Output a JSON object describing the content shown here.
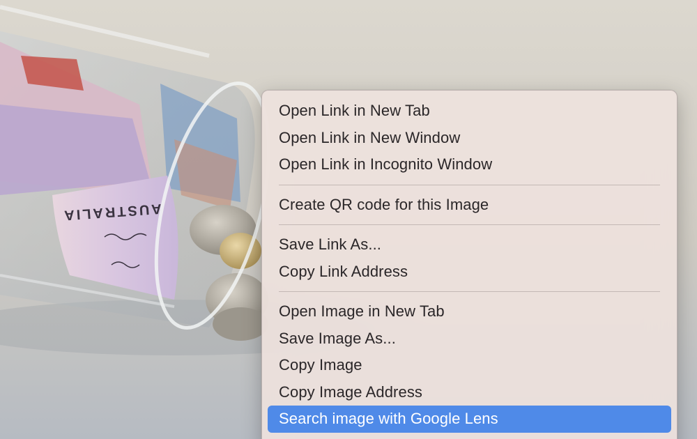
{
  "background": {
    "description_icon": "jar-of-money-photo",
    "banknote_text": "AUSTRALIA"
  },
  "context_menu": {
    "groups": [
      {
        "items": [
          {
            "label": "Open Link in New Tab"
          },
          {
            "label": "Open Link in New Window"
          },
          {
            "label": "Open Link in Incognito Window"
          }
        ]
      },
      {
        "items": [
          {
            "label": "Create QR code for this Image"
          }
        ]
      },
      {
        "items": [
          {
            "label": "Save Link As..."
          },
          {
            "label": "Copy Link Address"
          }
        ]
      },
      {
        "items": [
          {
            "label": "Open Image in New Tab"
          },
          {
            "label": "Save Image As..."
          },
          {
            "label": "Copy Image"
          },
          {
            "label": "Copy Image Address"
          },
          {
            "label": "Search image with Google Lens"
          }
        ]
      }
    ],
    "highlighted_item": "Search image with Google Lens",
    "highlight_color": "#4f8ae8"
  }
}
